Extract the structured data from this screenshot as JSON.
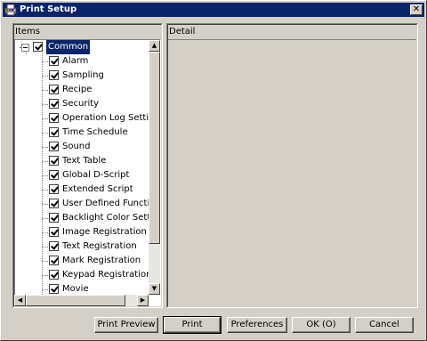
{
  "window": {
    "title": "Print Setup",
    "close_glyph": "✕",
    "icon": "app-print-icon",
    "title_bar_color": "#0a246a"
  },
  "items_panel": {
    "header": "Items",
    "root": {
      "label": "Common",
      "checked": true,
      "expanded": true,
      "expander_glyph": "−"
    },
    "children": [
      {
        "label": "Alarm",
        "checked": true
      },
      {
        "label": "Sampling",
        "checked": true
      },
      {
        "label": "Recipe",
        "checked": true
      },
      {
        "label": "Security",
        "checked": true
      },
      {
        "label": "Operation Log Settings",
        "checked": true
      },
      {
        "label": "Time Schedule",
        "checked": true
      },
      {
        "label": "Sound",
        "checked": true
      },
      {
        "label": "Text Table",
        "checked": true
      },
      {
        "label": "Global D-Script",
        "checked": true
      },
      {
        "label": "Extended Script",
        "checked": true
      },
      {
        "label": "User Defined Functions",
        "checked": true
      },
      {
        "label": "Backlight Color Settings",
        "checked": true
      },
      {
        "label": "Image Registration",
        "checked": true
      },
      {
        "label": "Text Registration",
        "checked": true
      },
      {
        "label": "Mark Registration",
        "checked": true
      },
      {
        "label": "Keypad Registration",
        "checked": true
      },
      {
        "label": "Movie",
        "checked": true
      }
    ],
    "vscroll": {
      "up": "▲",
      "down": "▼"
    },
    "hscroll": {
      "left": "◀",
      "right": "▶"
    }
  },
  "detail_panel": {
    "header": "Detail"
  },
  "buttons": {
    "print_preview": "Print Preview",
    "print": "Print",
    "preferences": "Preferences",
    "ok": "OK (O)",
    "cancel": "Cancel"
  }
}
